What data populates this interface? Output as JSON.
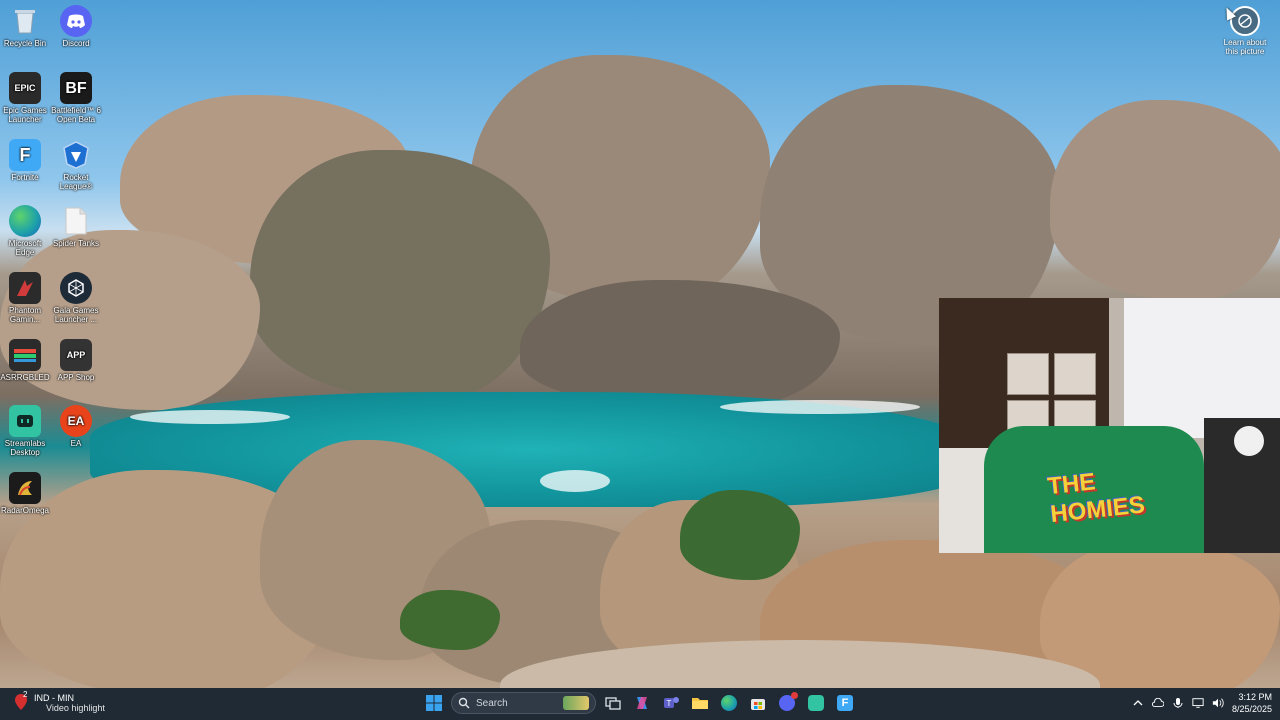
{
  "desktop": {
    "icons": [
      {
        "label": "Recycle Bin",
        "icon": "recycle-bin-icon",
        "color": "#d9e6ef"
      },
      {
        "label": "Discord",
        "icon": "discord-icon",
        "color": "#5865F2"
      },
      {
        "label": "Epic Games Launcher",
        "icon": "epic-games-icon",
        "color": "#2a2a2a",
        "glyph": "EPIC"
      },
      {
        "label": "Battlefield™ 6 Open Beta",
        "icon": "battlefield-icon",
        "color": "#1a1a1a",
        "glyph": "BF"
      },
      {
        "label": "Fortnite",
        "icon": "fortnite-icon",
        "color": "#3fa9f5",
        "glyph": "F"
      },
      {
        "label": "Rocket League®",
        "icon": "rocket-league-icon",
        "color": "#1d6fd1"
      },
      {
        "label": "Microsoft Edge",
        "icon": "edge-icon",
        "color": "#1fa3a8"
      },
      {
        "label": "Spider Tanks",
        "icon": "file-icon",
        "color": "#f3f3f3"
      },
      {
        "label": "Phantom Gamin...",
        "icon": "phantom-gaming-icon",
        "color": "#2b2b2b"
      },
      {
        "label": "Gala Games Launcher ...",
        "icon": "gala-games-icon",
        "color": "#1d2a38"
      },
      {
        "label": "ASRRGBLED",
        "icon": "asrock-rgb-icon",
        "color": "#2b2b2b"
      },
      {
        "label": "APP Shop",
        "icon": "app-shop-icon",
        "color": "#333333",
        "glyph": "APP"
      },
      {
        "label": "Streamlabs Desktop",
        "icon": "streamlabs-icon",
        "color": "#31c3a2"
      },
      {
        "label": "EA",
        "icon": "ea-icon",
        "color": "#e8431b",
        "glyph": "EA"
      },
      {
        "label": "RadarOmega",
        "icon": "radar-omega-icon",
        "color": "#1b1b1b"
      }
    ],
    "learn_about": "Learn about this picture"
  },
  "webcam": {
    "print_text": "THE HOMIES"
  },
  "taskbar": {
    "notification": {
      "line1": "IND - MIN",
      "line2": "Video highlight",
      "badge": "2"
    },
    "search_placeholder": "Search",
    "apps": [
      "task-view-icon",
      "copilot-icon",
      "teams-icon",
      "file-explorer-icon",
      "edge-icon",
      "store-icon",
      "discord-icon",
      "streamlabs-icon",
      "fortnite-icon"
    ],
    "time": "3:12 PM",
    "date": "8/25/2025"
  }
}
